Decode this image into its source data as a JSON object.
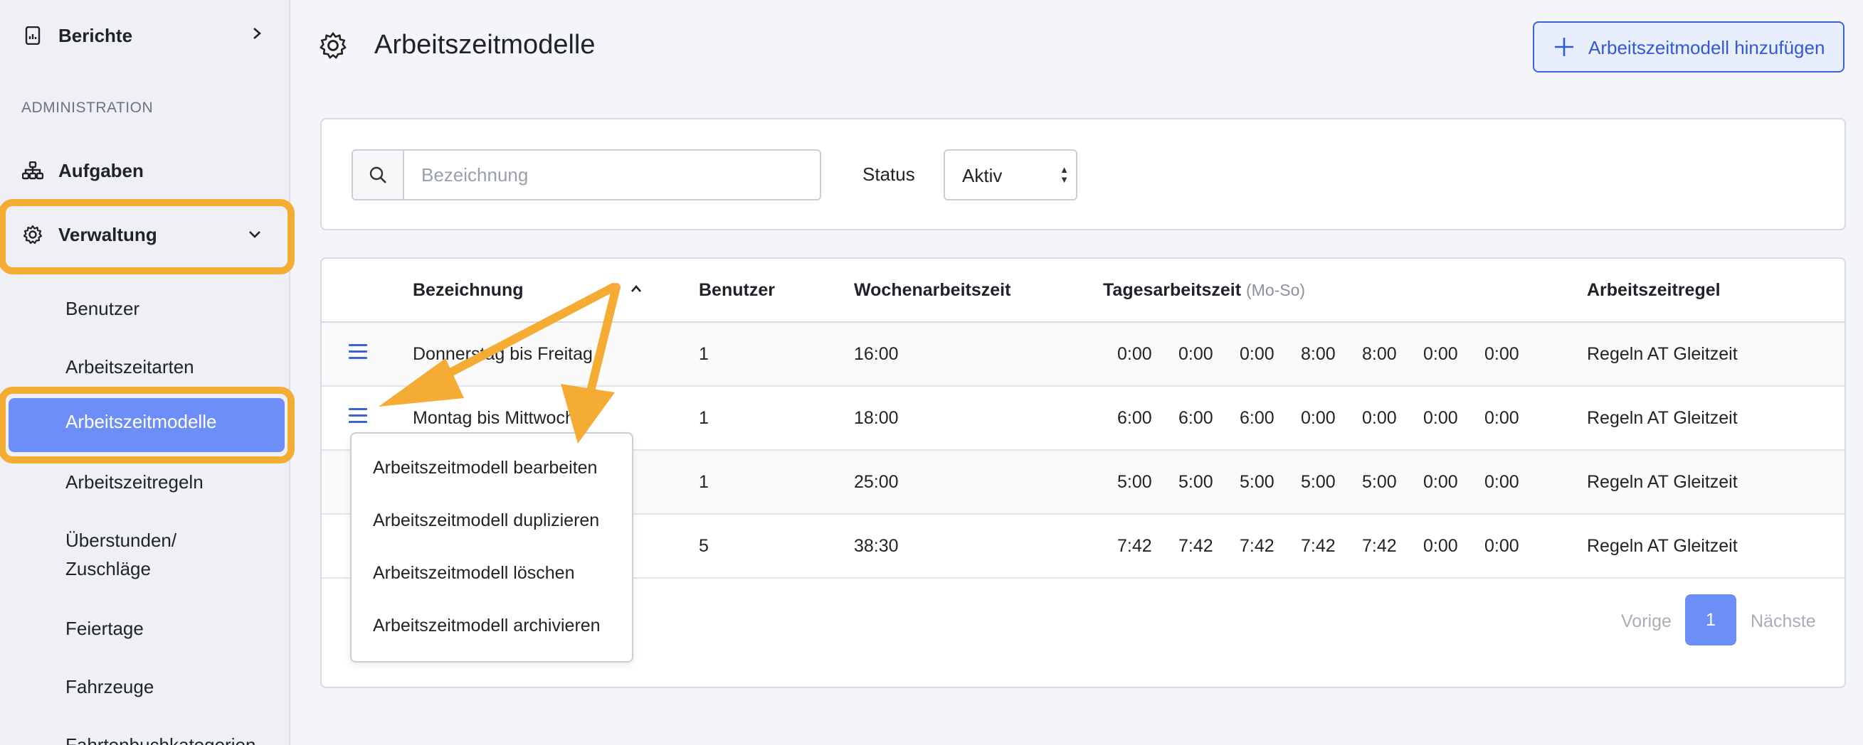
{
  "sidebar": {
    "top_item": {
      "label": "Berichte",
      "icon": "report-icon"
    },
    "section_title": "ADMINISTRATION",
    "items": [
      {
        "label": "Aufgaben",
        "icon": "sitemap-icon"
      },
      {
        "label": "Verwaltung",
        "icon": "gear-icon"
      }
    ],
    "sub_items": [
      {
        "label": "Benutzer"
      },
      {
        "label": "Arbeitszeitarten"
      },
      {
        "label": "Arbeitszeitmodelle",
        "active": true
      },
      {
        "label": "Arbeitszeitregeln"
      },
      {
        "label": "Überstunden/"
      },
      {
        "label": "Zuschläge"
      },
      {
        "label": "Feiertage"
      },
      {
        "label": "Fahrzeuge"
      },
      {
        "label": "Fahrtenbuchkategorien"
      }
    ]
  },
  "header": {
    "title": "Arbeitszeitmodelle",
    "add_button": "Arbeitszeitmodell hinzufügen"
  },
  "filter": {
    "search_placeholder": "Bezeichnung",
    "search_value": "",
    "status_label": "Status",
    "status_value": "Aktiv"
  },
  "table": {
    "columns": {
      "name": "Bezeichnung",
      "users": "Benutzer",
      "weekly": "Wochenarbeitszeit",
      "daily": "Tagesarbeitszeit",
      "daily_hint": "(Mo-So)",
      "rule": "Arbeitszeitregel"
    },
    "rows": [
      {
        "name": "Donnerstag bis Freitag",
        "users": "1",
        "weekly": "16:00",
        "days": [
          "0:00",
          "0:00",
          "0:00",
          "8:00",
          "8:00",
          "0:00",
          "0:00"
        ],
        "rule": "Regeln AT Gleitzeit"
      },
      {
        "name": "Montag bis Mittwoch",
        "users": "1",
        "weekly": "18:00",
        "days": [
          "6:00",
          "6:00",
          "6:00",
          "0:00",
          "0:00",
          "0:00",
          "0:00"
        ],
        "rule": "Regeln AT Gleitzeit"
      },
      {
        "name": "",
        "users": "1",
        "weekly": "25:00",
        "days": [
          "5:00",
          "5:00",
          "5:00",
          "5:00",
          "5:00",
          "0:00",
          "0:00"
        ],
        "rule": "Regeln AT Gleitzeit"
      },
      {
        "name": "",
        "users": "5",
        "weekly": "38:30",
        "days": [
          "7:42",
          "7:42",
          "7:42",
          "7:42",
          "7:42",
          "0:00",
          "0:00"
        ],
        "rule": "Regeln AT Gleitzeit"
      }
    ]
  },
  "context_menu": {
    "items": [
      "Arbeitszeitmodell bearbeiten",
      "Arbeitszeitmodell duplizieren",
      "Arbeitszeitmodell löschen",
      "Arbeitszeitmodell archivieren"
    ]
  },
  "pagination": {
    "prev": "Vorige",
    "current": "1",
    "next": "Nächste"
  },
  "colors": {
    "accent": "#6e8ef7",
    "highlight": "#f5ac34",
    "link": "#3059d2"
  }
}
